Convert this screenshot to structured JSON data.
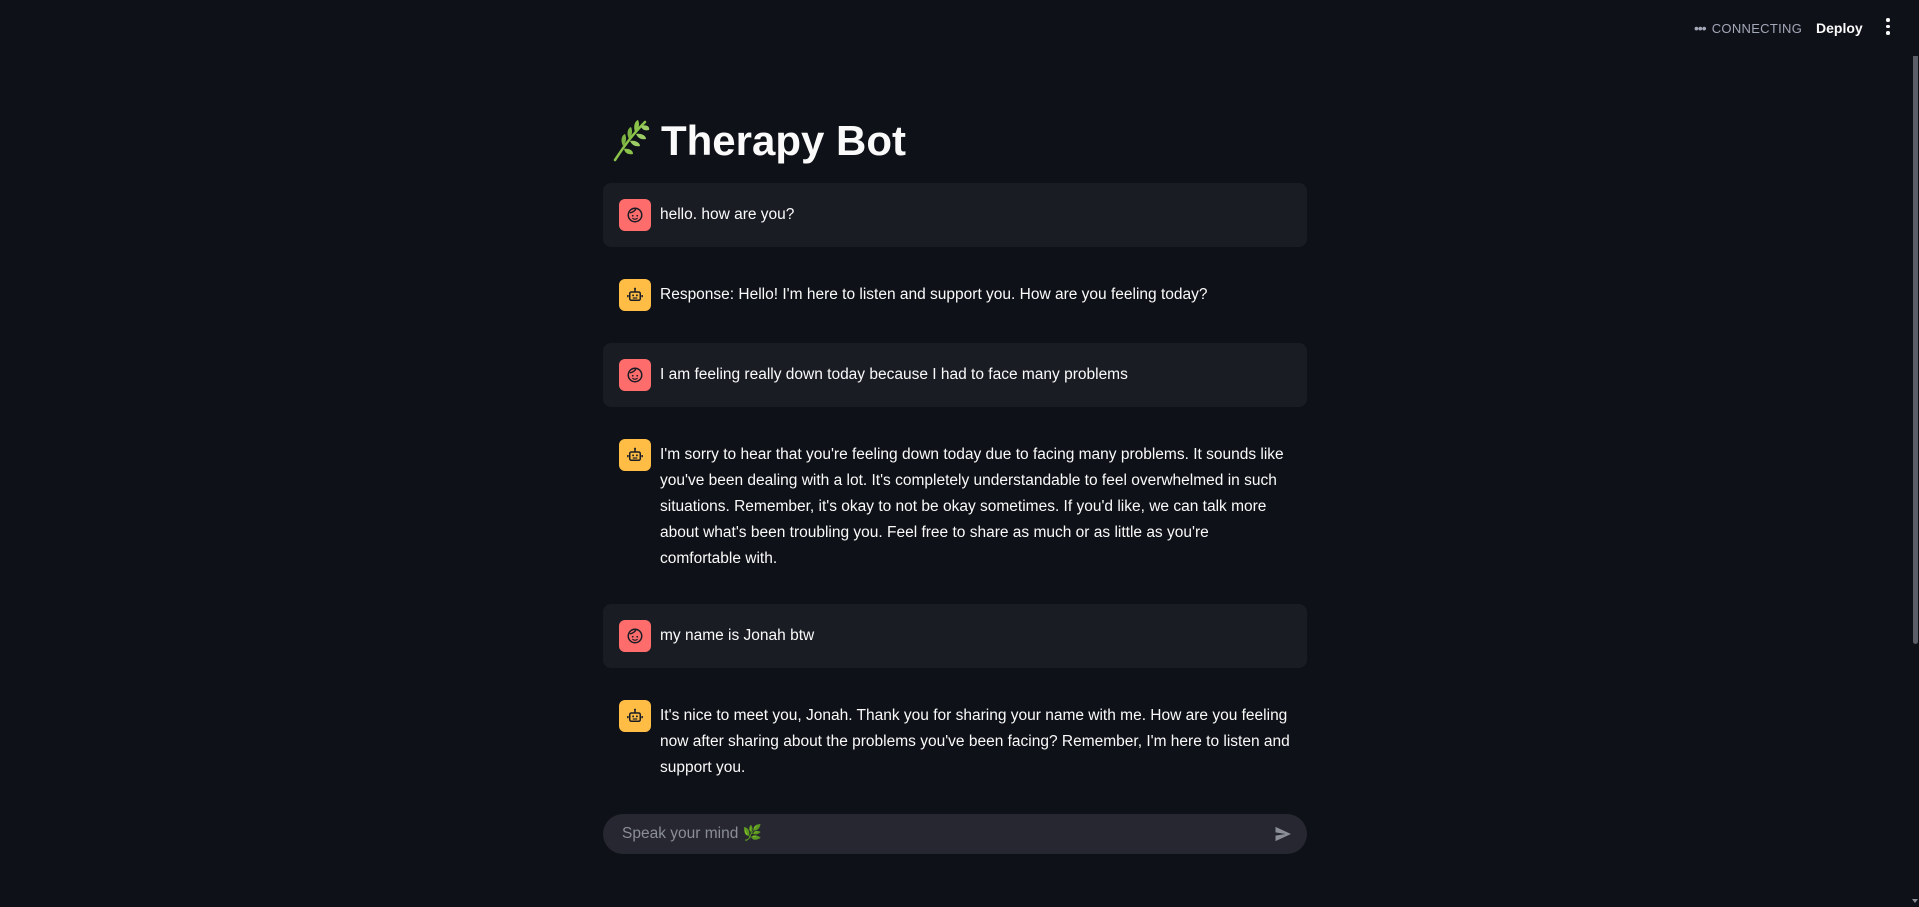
{
  "header": {
    "status_label": "CONNECTING",
    "deploy_label": "Deploy"
  },
  "app": {
    "title": "Therapy Bot"
  },
  "messages": [
    {
      "role": "user",
      "text": "hello. how are you?"
    },
    {
      "role": "assistant",
      "text": "Response: Hello! I'm here to listen and support you. How are you feeling today?"
    },
    {
      "role": "user",
      "text": "I am feeling really down today because I had to face many problems"
    },
    {
      "role": "assistant",
      "text": "I'm sorry to hear that you're feeling down today due to facing many problems. It sounds like you've been dealing with a lot. It's completely understandable to feel overwhelmed in such situations. Remember, it's okay to not be okay sometimes. If you'd like, we can talk more about what's been troubling you. Feel free to share as much or as little as you're comfortable with."
    },
    {
      "role": "user",
      "text": "my name is Jonah btw"
    },
    {
      "role": "assistant",
      "text": "It's nice to meet you, Jonah. Thank you for sharing your name with me. How are you feeling now after sharing about the problems you've been facing? Remember, I'm here to listen and support you."
    },
    {
      "role": "user",
      "text": ""
    }
  ],
  "chat_input": {
    "placeholder": "Speak your mind 🌿",
    "value": ""
  },
  "colors": {
    "background": "#0e1117",
    "user_bubble": "#1a1c24",
    "user_avatar": "#ff6c6c",
    "bot_avatar": "#ffbd45",
    "input_bg": "#262730"
  },
  "icons": {
    "title": "herb-leaf-icon",
    "user_avatar": "face-icon",
    "bot_avatar": "robot-icon",
    "send": "send-arrow-icon",
    "menu": "kebab-menu-icon",
    "status": "more-horizontal-icon"
  }
}
